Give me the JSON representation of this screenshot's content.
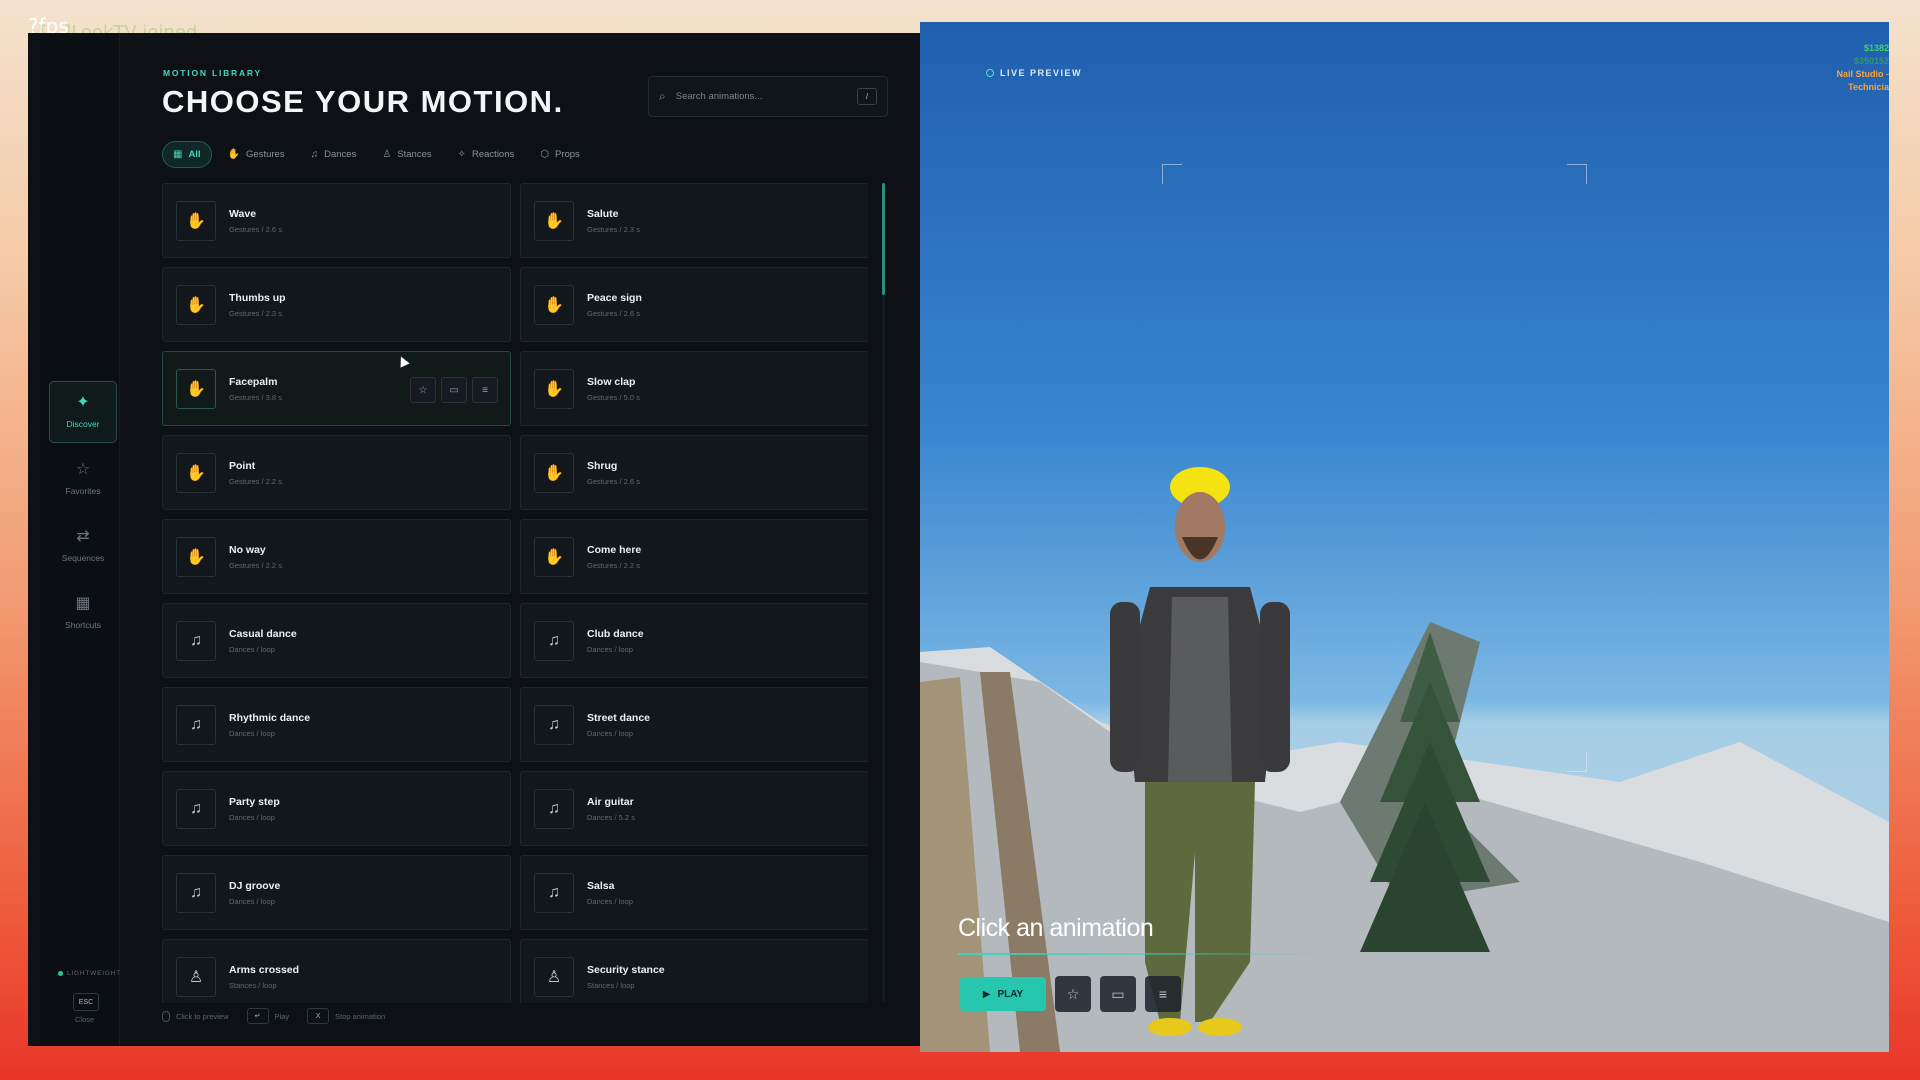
{
  "overlay": {
    "fps": "?fps",
    "join_message": "[...]LookTV joined"
  },
  "sidebar": {
    "items": [
      {
        "label": "Discover",
        "icon": "sparkle-icon",
        "active": true
      },
      {
        "label": "Favorites",
        "icon": "star-icon",
        "active": false
      },
      {
        "label": "Sequences",
        "icon": "sequence-icon",
        "active": false
      },
      {
        "label": "Shortcuts",
        "icon": "grid-icon",
        "active": false
      }
    ],
    "mode_label": "LIGHTWEIGHT",
    "close_key": "ESC",
    "close_label": "Close"
  },
  "header": {
    "eyebrow": "MOTION LIBRARY",
    "title": "CHOOSE YOUR MOTION.",
    "search_placeholder": "Search animations...",
    "search_shortcut": "/"
  },
  "tabs": [
    {
      "label": "All",
      "icon": "grid-icon",
      "active": true
    },
    {
      "label": "Gestures",
      "icon": "hand-icon",
      "active": false
    },
    {
      "label": "Dances",
      "icon": "music-note-icon",
      "active": false
    },
    {
      "label": "Stances",
      "icon": "person-icon",
      "active": false
    },
    {
      "label": "Reactions",
      "icon": "sparkle-icon",
      "active": false
    },
    {
      "label": "Props",
      "icon": "box-icon",
      "active": false
    }
  ],
  "animations": [
    {
      "name": "Wave",
      "meta": "Gestures / 2.6 s",
      "icon": "hand-icon"
    },
    {
      "name": "Salute",
      "meta": "Gestures / 2.3 s",
      "icon": "hand-icon"
    },
    {
      "name": "Thumbs up",
      "meta": "Gestures / 2.3 s",
      "icon": "hand-icon"
    },
    {
      "name": "Peace sign",
      "meta": "Gestures / 2.6 s",
      "icon": "hand-icon"
    },
    {
      "name": "Facepalm",
      "meta": "Gestures / 3.8 s",
      "icon": "hand-icon",
      "hovered": true
    },
    {
      "name": "Slow clap",
      "meta": "Gestures / 5.0 s",
      "icon": "hand-icon"
    },
    {
      "name": "Point",
      "meta": "Gestures / 2.2 s",
      "icon": "hand-icon"
    },
    {
      "name": "Shrug",
      "meta": "Gestures / 2.6 s",
      "icon": "hand-icon"
    },
    {
      "name": "No way",
      "meta": "Gestures / 2.2 s",
      "icon": "hand-icon"
    },
    {
      "name": "Come here",
      "meta": "Gestures / 2.2 s",
      "icon": "hand-icon"
    },
    {
      "name": "Casual dance",
      "meta": "Dances / loop",
      "icon": "music-note-icon"
    },
    {
      "name": "Club dance",
      "meta": "Dances / loop",
      "icon": "music-note-icon"
    },
    {
      "name": "Rhythmic dance",
      "meta": "Dances / loop",
      "icon": "music-note-icon"
    },
    {
      "name": "Street dance",
      "meta": "Dances / loop",
      "icon": "music-note-icon"
    },
    {
      "name": "Party step",
      "meta": "Dances / loop",
      "icon": "music-note-icon"
    },
    {
      "name": "Air guitar",
      "meta": "Dances / 5.2 s",
      "icon": "music-note-icon"
    },
    {
      "name": "DJ groove",
      "meta": "Dances / loop",
      "icon": "music-note-icon"
    },
    {
      "name": "Salsa",
      "meta": "Dances / loop",
      "icon": "music-note-icon"
    },
    {
      "name": "Arms crossed",
      "meta": "Stances / loop",
      "icon": "person-icon"
    },
    {
      "name": "Security stance",
      "meta": "Stances / loop",
      "icon": "person-icon"
    }
  ],
  "card_actions": [
    "star-icon",
    "camera-icon",
    "add-to-sequence-icon"
  ],
  "footer": {
    "preview_label": "Click to preview",
    "play_key": "↵",
    "play_label": "Play",
    "stop_key": "X",
    "stop_label": "Stop animation"
  },
  "preview": {
    "badge": "LIVE PREVIEW",
    "prompt": "Click an animation",
    "play_label": "PLAY",
    "hud_lines": [
      "$1382",
      "$350152",
      "Nail Studio -",
      "Technicia"
    ]
  },
  "colors": {
    "accent": "#46d6bd",
    "play_button": "#27c6ae",
    "panel_bg": "#0d1115"
  }
}
